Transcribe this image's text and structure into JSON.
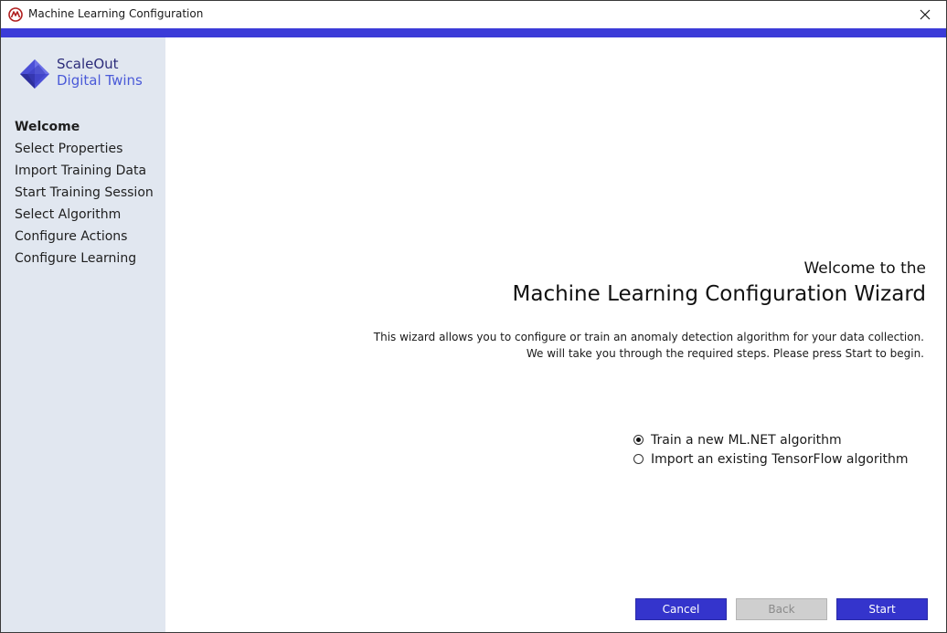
{
  "window": {
    "title": "Machine Learning Configuration",
    "app_icon": "app-logo-icon",
    "close_icon": "close-icon"
  },
  "colors": {
    "accent": "#3b3bd8",
    "sidebar_bg": "#e1e7f0",
    "button_primary": "#3434cc",
    "button_disabled": "#cfcfcf"
  },
  "logo": {
    "line1": "ScaleOut",
    "line2": "Digital Twins"
  },
  "steps": [
    {
      "label": "Welcome",
      "active": true
    },
    {
      "label": "Select Properties",
      "active": false
    },
    {
      "label": "Import Training Data",
      "active": false
    },
    {
      "label": "Start Training Session",
      "active": false
    },
    {
      "label": "Select Algorithm",
      "active": false
    },
    {
      "label": "Configure Actions",
      "active": false
    },
    {
      "label": "Configure Learning",
      "active": false
    }
  ],
  "main": {
    "welcome_line1": "Welcome to the",
    "welcome_line2": "Machine Learning Configuration Wizard",
    "description_line1": "This wizard allows you to configure or train an anomaly detection algorithm for your data collection.",
    "description_line2": "We will take you through the required steps. Please press Start to begin.",
    "options": [
      {
        "label": "Train a new ML.NET algorithm",
        "checked": true
      },
      {
        "label": "Import an existing TensorFlow algorithm",
        "checked": false
      }
    ]
  },
  "buttons": {
    "cancel": "Cancel",
    "back": "Back",
    "start": "Start",
    "back_disabled": true
  }
}
